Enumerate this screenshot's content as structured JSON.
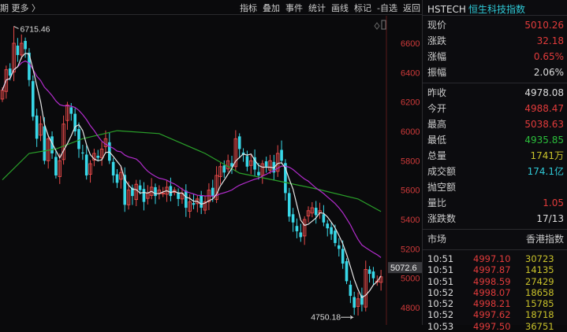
{
  "toolbar": {
    "period": "期  更多 〉",
    "items": [
      "指标",
      "叠加",
      "事件",
      "统计",
      "画线",
      "标记",
      "-自选",
      "返回"
    ]
  },
  "panel": {
    "code": "HSTECH",
    "name": "恒生科技指数",
    "quote": [
      {
        "label": "现价",
        "value": "5010.26",
        "color": "#e23b3b"
      },
      {
        "label": "涨跌",
        "value": "32.18",
        "color": "#e23b3b"
      },
      {
        "label": "涨幅",
        "value": "0.65%",
        "color": "#e23b3b"
      },
      {
        "label": "振幅",
        "value": "2.06%",
        "color": "#dddddd"
      }
    ],
    "stats": [
      {
        "label": "昨收",
        "value": "4978.08",
        "color": "#dddddd"
      },
      {
        "label": "今开",
        "value": "4988.47",
        "color": "#e23b3b"
      },
      {
        "label": "最高",
        "value": "5038.63",
        "color": "#e23b3b"
      },
      {
        "label": "最低",
        "value": "4935.85",
        "color": "#2bbf3b"
      },
      {
        "label": "总量",
        "value": "1741万",
        "color": "#c9c22a"
      },
      {
        "label": "成交额",
        "value": "174.1亿",
        "color": "#2fc9d6"
      },
      {
        "label": "抛空额",
        "value": "",
        "color": "#dddddd"
      },
      {
        "label": "量比",
        "value": "1.05",
        "color": "#e23b3b"
      },
      {
        "label": "涨跌数",
        "value": "17/13",
        "color": "#dddddd"
      }
    ],
    "market_label": "市场",
    "market_value": "香港指数",
    "ticks": [
      {
        "time": "10:51",
        "price": "4997.10",
        "vol": "30723"
      },
      {
        "time": "10:51",
        "price": "4997.87",
        "vol": "14135"
      },
      {
        "time": "10:51",
        "price": "4998.59",
        "vol": "27429"
      },
      {
        "time": "10:52",
        "price": "4998.07",
        "vol": "18658"
      },
      {
        "time": "10:52",
        "price": "4998.21",
        "vol": "15785"
      },
      {
        "time": "10:52",
        "price": "4997.62",
        "vol": "18718"
      },
      {
        "time": "10:53",
        "price": "4997.50",
        "vol": "36751"
      }
    ]
  },
  "chart_data": {
    "type": "candlestick",
    "y_ticks": [
      "6600",
      "6400",
      "6200",
      "6000",
      "5800",
      "5600",
      "5400",
      "5200",
      "5000",
      "4800"
    ],
    "ylim": [
      4700,
      6720
    ],
    "high_label": "6715.46",
    "high_value": 6715.46,
    "high_index": 3,
    "low_label": "4750.18",
    "low_value": 4750.18,
    "low_index": 92,
    "last_label": "5072.6",
    "last_value": 5072.6,
    "up_color": "#e84a4a",
    "down_color": "#38d8e8",
    "closes": [
      6280,
      6420,
      6380,
      6600,
      6520,
      6600,
      6560,
      6350,
      6100,
      5950,
      6050,
      5800,
      5950,
      5850,
      5700,
      5800,
      6050,
      6180,
      6120,
      6000,
      5880,
      5850,
      5700,
      5780,
      5850,
      5820,
      5880,
      5950,
      5800,
      5700,
      5650,
      5720,
      5500,
      5600,
      5560,
      5640,
      5600,
      5520,
      5580,
      5620,
      5560,
      5600,
      5580,
      5620,
      5560,
      5600,
      5540,
      5580,
      5480,
      5520,
      5500,
      5540,
      5480,
      5520,
      5600,
      5560,
      5700,
      5760,
      5720,
      5800,
      5760,
      5950,
      5880,
      5840,
      5760,
      5800,
      5740,
      5700,
      5780,
      5760,
      5800,
      5720,
      5850,
      5800,
      5580,
      5420,
      5380,
      5320,
      5280,
      5400,
      5460,
      5480,
      5430,
      5460,
      5380,
      5340,
      5300,
      5240,
      5200,
      5100,
      4980,
      4880,
      4800,
      4860,
      4820,
      5060,
      5030,
      5000,
      4980,
      5010
    ],
    "ma_long": [
      [
        0,
        5670
      ],
      [
        7,
        5850
      ],
      [
        14,
        5880
      ],
      [
        21,
        5950
      ],
      [
        30,
        6005
      ],
      [
        41,
        5985
      ],
      [
        53,
        5850
      ],
      [
        62,
        5716
      ],
      [
        72,
        5663
      ],
      [
        82,
        5609
      ],
      [
        93,
        5540
      ],
      [
        99,
        5454
      ]
    ],
    "ma_colors": {
      "ma5": "#e6e6e6",
      "ma20": "#b22ccc",
      "ma_long": "#2aa02a"
    }
  }
}
